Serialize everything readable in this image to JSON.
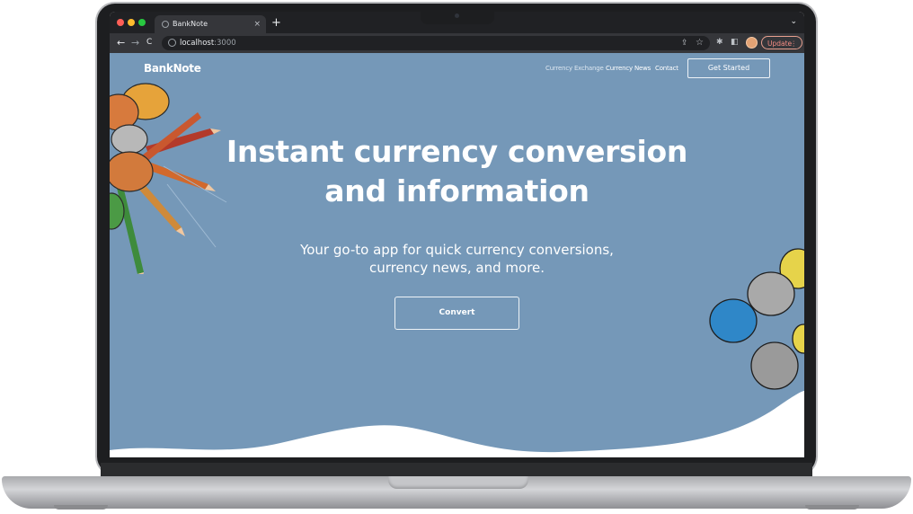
{
  "browser": {
    "tab_title": "BankNote",
    "tab_close": "×",
    "new_tab": "+",
    "tab_menu": "⌄",
    "url_host": "localhost",
    "url_port": ":3000",
    "update_label": "Update",
    "update_menu": "⋮",
    "back": "←",
    "forward": "→",
    "reload": "C",
    "share_icon": "⇪",
    "star_icon": "☆",
    "extensions_icon": "✱",
    "sidepanel_icon": "◧"
  },
  "site": {
    "logo": "BankNote",
    "nav": [
      "Currency Exchange",
      "Currency News",
      "Contact"
    ],
    "cta_top": "Get Started",
    "hero_title_line1": "Instant currency conversion",
    "hero_title_line2": "and information",
    "hero_sub_line1": "Your go-to app for quick currency conversions,",
    "hero_sub_line2": "currency news, and more.",
    "convert_label": "Convert"
  },
  "colors": {
    "page_bg": "#7598b8",
    "wave": "#ffffff"
  }
}
